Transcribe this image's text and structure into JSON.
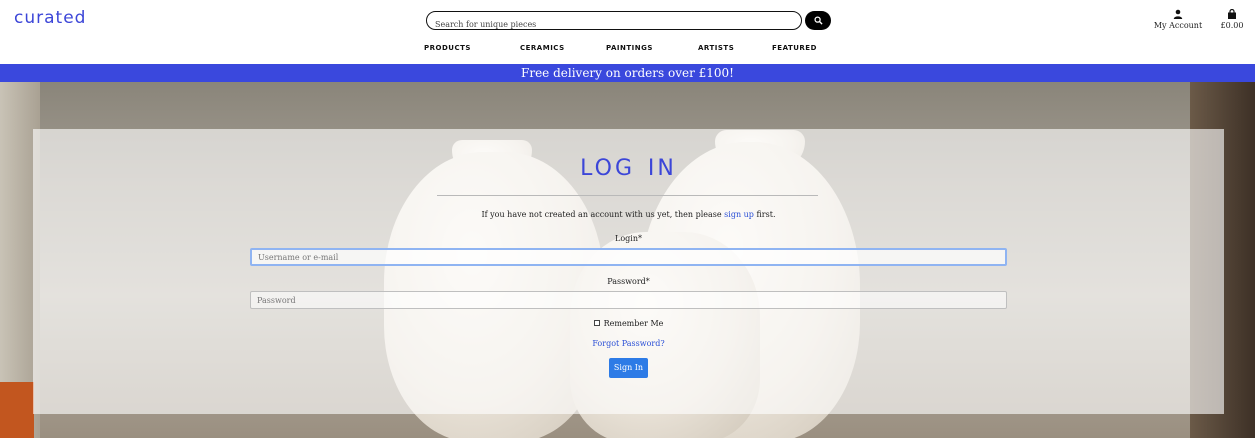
{
  "header": {
    "logo": "curated",
    "search": {
      "placeholder": "Search for unique pieces"
    },
    "account_label": "My Account",
    "bag_total": "£0.00",
    "nav": [
      "products",
      "ceramics",
      "paintings",
      "artists",
      "featured"
    ]
  },
  "banner": {
    "text": "Free delivery on orders over £100!"
  },
  "login": {
    "title": "Log In",
    "intro_before": "If you have not created an account with us yet, then please ",
    "intro_link": "sign up",
    "intro_after": " first.",
    "login_label": "Login*",
    "login_placeholder": "Username or e-mail",
    "password_label": "Password*",
    "password_placeholder": "Password",
    "remember_label": "Remember Me",
    "forgot_label": "Forgot Password?",
    "signin_label": "Sign In"
  },
  "colors": {
    "accent": "#3c46d8",
    "banner": "#3a48dd",
    "button": "#2d7be6",
    "link": "#2a4fd6"
  },
  "icons": {
    "search": "search-icon",
    "account": "user-icon",
    "bag": "shopping-bag-icon"
  }
}
